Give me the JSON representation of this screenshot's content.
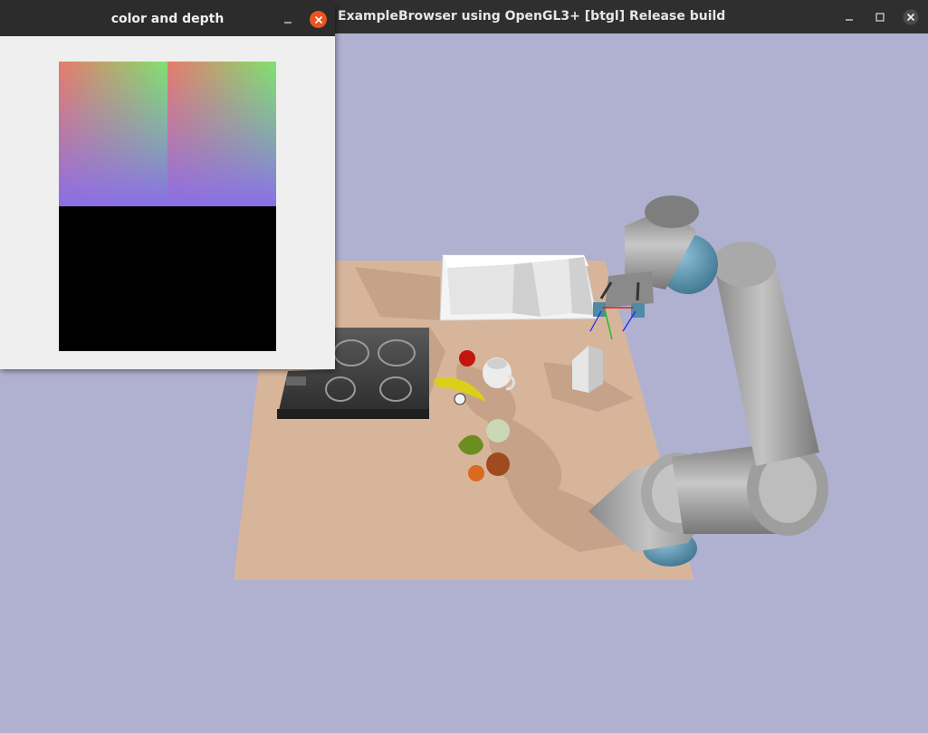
{
  "main_window": {
    "title": "ExampleBrowser using OpenGL3+ [btgl] Release build",
    "controls": {
      "minimize_icon": "minimize-icon",
      "maximize_icon": "maximize-icon",
      "close_icon": "close-icon"
    }
  },
  "color_depth_window": {
    "title": "color and depth",
    "controls": {
      "minimize_icon": "minimize-icon",
      "close_icon": "close-icon"
    },
    "close_color": "#e95420"
  },
  "colors": {
    "background": "#b0b0d0",
    "titlebar": "#2f2f2f",
    "table": "#d7b59a",
    "robot_gray": "#9a9a9a",
    "robot_joint": "#5f96ad",
    "depth_black": "#000000"
  }
}
